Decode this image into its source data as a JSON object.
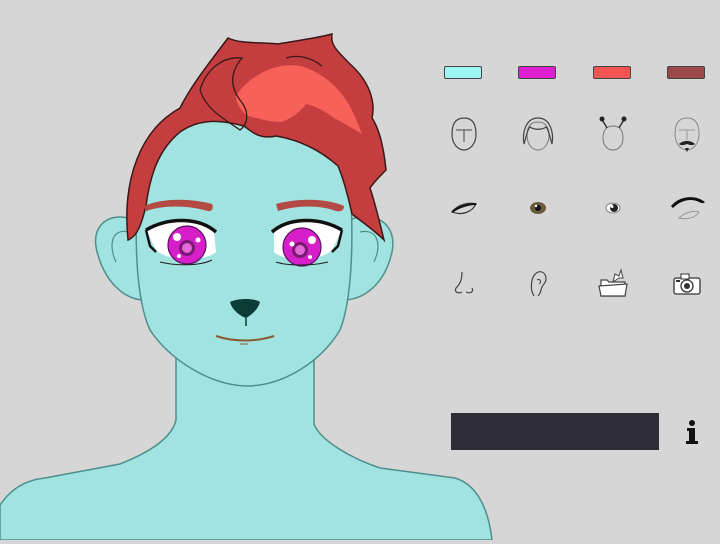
{
  "name_bar": {
    "value": ""
  },
  "palette": [
    {
      "label": "cyan",
      "color": "#9ef6f4"
    },
    {
      "label": "magenta",
      "color": "#e020d0"
    },
    {
      "label": "coral",
      "color": "#f25553"
    },
    {
      "label": "maroon",
      "color": "#9a4848"
    }
  ],
  "tools": [
    {
      "row": "row-1",
      "icon": "head-shape-icon"
    },
    {
      "row": "row-1",
      "icon": "hair-icon"
    },
    {
      "row": "row-1",
      "icon": "antennae-icon"
    },
    {
      "row": "row-1",
      "icon": "facial-hair-icon"
    },
    {
      "row": "row-2",
      "icon": "eye-shape-icon"
    },
    {
      "row": "row-2",
      "icon": "iris-icon"
    },
    {
      "row": "row-2",
      "icon": "pupil-icon"
    },
    {
      "row": "row-2",
      "icon": "eyebrow-icon"
    },
    {
      "row": "row-3",
      "icon": "nose-icon"
    },
    {
      "row": "row-3",
      "icon": "ear-icon"
    },
    {
      "row": "row-3",
      "icon": "folder-icon"
    },
    {
      "row": "row-3",
      "icon": "camera-icon"
    }
  ],
  "character": {
    "skin_color": "#a0e3e1",
    "hair_color": "#c53e3f",
    "hair_highlight": "#f86159",
    "eye_color": "#d61ec9",
    "brow_color": "#b54a44"
  }
}
